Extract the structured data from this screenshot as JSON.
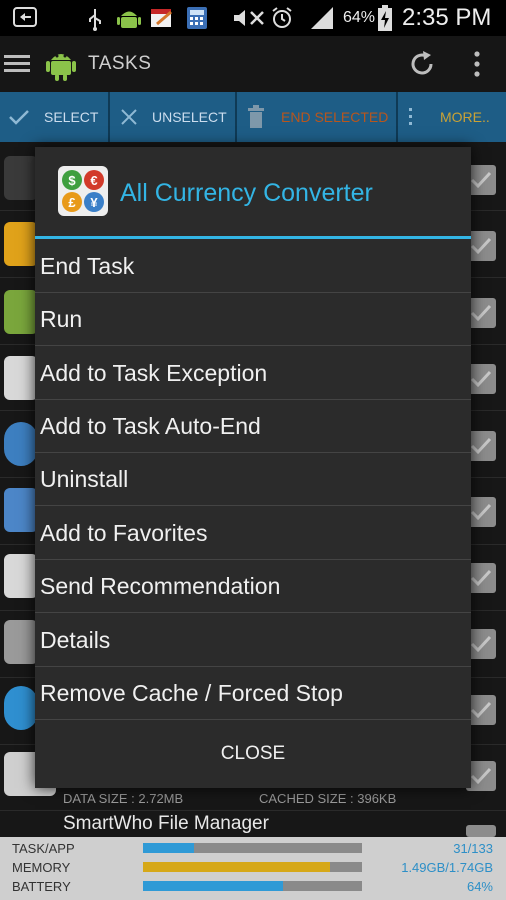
{
  "status_bar": {
    "battery_percent": "64%",
    "time": "2:35 PM"
  },
  "action_bar": {
    "title": "TASKS",
    "icons": [
      "menu-icon",
      "android-icon",
      "refresh-icon",
      "overflow-icon"
    ]
  },
  "toolbar": {
    "select_label": "SELECT",
    "unselect_label": "UNSELECT",
    "end_selected_label": "END SELECTED",
    "more_label": "MORE.."
  },
  "background_list": {
    "visible_detail": {
      "data_size": "DATA SIZE : 2.72MB",
      "cached_size": "CACHED SIZE : 396KB"
    },
    "last_app_name": "SmartWho File Manager"
  },
  "dialog": {
    "title": "All Currency Converter",
    "items": [
      "End Task",
      "Run",
      "Add to Task Exception",
      "Add to Task Auto-End",
      "Uninstall",
      "Add to Favorites",
      "Send Recommendation",
      "Details",
      "Remove Cache / Forced Stop"
    ],
    "close_label": "CLOSE"
  },
  "footer": {
    "task": {
      "label": "TASK/APP",
      "value": "31/133",
      "fraction": 0.233,
      "color": "#2f9ad6"
    },
    "memory": {
      "label": "MEMORY",
      "value": "1.49GB/1.74GB",
      "fraction": 0.856,
      "color": "#d6a818"
    },
    "battery": {
      "label": "BATTERY",
      "value": "64%",
      "fraction": 0.64,
      "color": "#2f9ad6"
    }
  },
  "colors": {
    "accent": "#33b5e5",
    "toolbar": "#1e5d86",
    "end_selected_text": "#b8561d",
    "more_text": "#c9a236"
  }
}
